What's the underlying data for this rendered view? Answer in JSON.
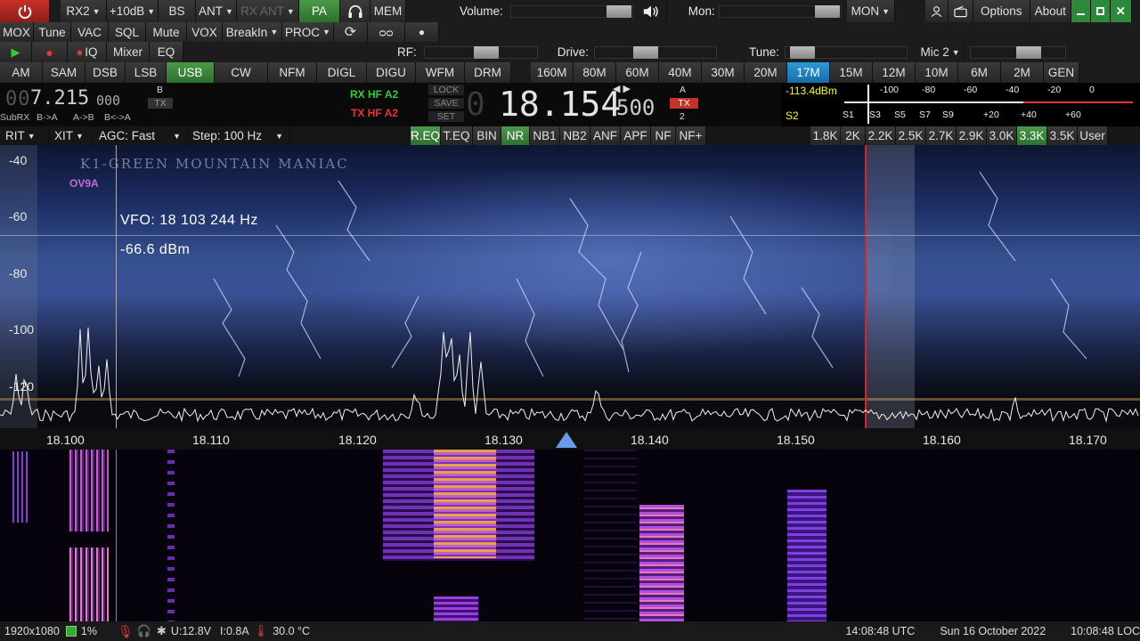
{
  "row1": {
    "buttons": [
      "RX2",
      "+10dB",
      "BS",
      "ANT",
      "RX ANT",
      "PA",
      "MEM"
    ],
    "volume_label": "Volume:",
    "mon_label": "Mon:",
    "mon_button": "MON",
    "options": "Options",
    "about": "About"
  },
  "row2": [
    "MOX",
    "Tune",
    "VAC",
    "SQL",
    "Mute",
    "VOX",
    "BreakIn",
    "PROC"
  ],
  "row3": {
    "iq": "IQ",
    "mixer": "Mixer",
    "eq": "EQ",
    "rf_label": "RF:",
    "drive_label": "Drive:",
    "tune_label": "Tune:",
    "mic_label": "Mic 2"
  },
  "modes": [
    "AM",
    "SAM",
    "DSB",
    "LSB",
    "USB",
    "CW",
    "NFM",
    "DIGL",
    "DIGU",
    "WFM",
    "DRM"
  ],
  "active_mode": "USB",
  "bands": [
    "160M",
    "80M",
    "60M",
    "40M",
    "30M",
    "20M",
    "17M",
    "15M",
    "12M",
    "10M",
    "6M",
    "2M",
    "GEN"
  ],
  "active_band": "17M",
  "vfo": {
    "vfo_b_freq_main": "7.215",
    "vfo_b_freq_sub": "000",
    "vfo_b_label": "B",
    "vfo_b_tx": "TX",
    "subrx": "SubRX",
    "b_to_a": "B->A",
    "a_to_b": "A->B",
    "swap": "B<->A",
    "rx_hf": "RX HF",
    "tx_hf": "TX HF",
    "a2": "A2",
    "lock": "LOCK",
    "save": "SAVE",
    "set": "SET",
    "vfo_a_freq_main": "18.154",
    "vfo_a_freq_sub": "500",
    "vfo_a_label": "A",
    "vfo_a_tx": "TX",
    "vfo_a_rx": "2",
    "meter_dbm": "-113.4dBm",
    "meter_s": "S2",
    "scale_top": [
      "-100",
      "-80",
      "-60",
      "-40",
      "-20",
      "0"
    ],
    "scale_bottom": [
      "S1",
      "S3",
      "S5",
      "S7",
      "S9",
      "+20",
      "+40",
      "+60"
    ]
  },
  "row6": {
    "rit": "RIT",
    "xit": "XIT",
    "agc": "AGC: Fast",
    "step": "Step: 100 Hz",
    "dsp": [
      "R.EQ",
      "T.EQ",
      "BIN",
      "NR",
      "NB1",
      "NB2",
      "ANF",
      "APF",
      "NF",
      "NF+"
    ],
    "active_dsp": [
      "R.EQ",
      "NR"
    ],
    "filters": [
      "1.8K",
      "2K",
      "2.2K",
      "2.5K",
      "2.7K",
      "2.9K",
      "3.0K",
      "3.3K",
      "3.5K",
      "User"
    ],
    "active_filter": "3.3K"
  },
  "panadapter": {
    "db_labels": [
      "-40",
      "-60",
      "-80",
      "-100",
      "-120"
    ],
    "skin_title": "K1-GREEN MOUNTAIN MANIAC",
    "spot": "OV9A",
    "cursor_freq": "VFO: 18 103 244 Hz",
    "cursor_dbm": "-66.6 dBm"
  },
  "freq_labels": [
    "18.100",
    "18.110",
    "18.120",
    "18.130",
    "18.140",
    "18.150",
    "18.160",
    "18.170"
  ],
  "status": {
    "resolution": "1920x1080",
    "cpu": "1%",
    "voltage": "U:12.8V",
    "current": "I:0.8A",
    "temp": "30.0 °C",
    "utc": "14:08:48 UTC",
    "date": "Sun 16 October 2022",
    "local": "10:08:48 LOC"
  }
}
